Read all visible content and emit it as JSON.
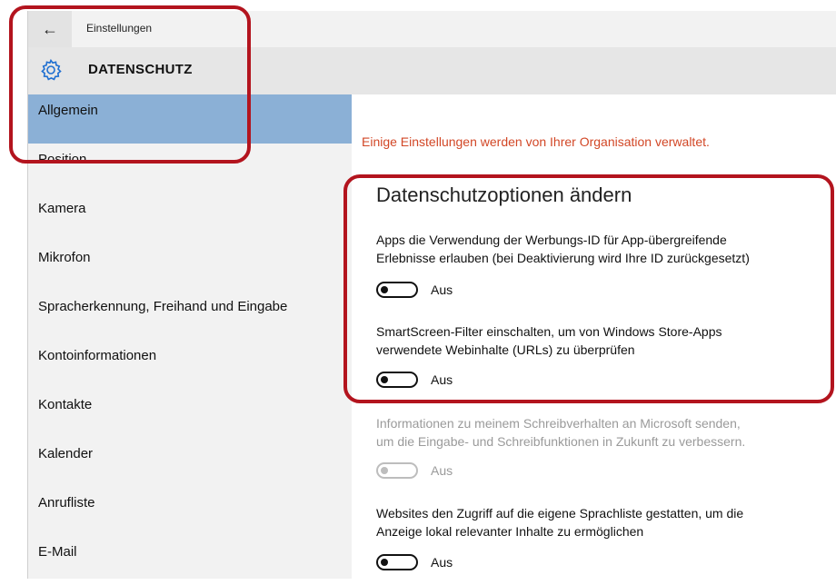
{
  "window": {
    "title": "Einstellungen",
    "back_icon": "arrow-left-icon"
  },
  "header": {
    "icon": "gear-icon",
    "title": "DATENSCHUTZ"
  },
  "sidebar": {
    "items": [
      {
        "label": "Allgemein",
        "active": true
      },
      {
        "label": "Position"
      },
      {
        "label": "Kamera"
      },
      {
        "label": "Mikrofon"
      },
      {
        "label": "Spracherkennung, Freihand und Eingabe"
      },
      {
        "label": "Kontoinformationen"
      },
      {
        "label": "Kontakte"
      },
      {
        "label": "Kalender"
      },
      {
        "label": "Anrufliste"
      },
      {
        "label": "E-Mail"
      }
    ]
  },
  "content": {
    "org_notice": "Einige Einstellungen werden von Ihrer Organisation verwaltet.",
    "section_title": "Datenschutzoptionen ändern",
    "options": [
      {
        "line1": "Apps die Verwendung der Werbungs-ID für App-übergreifende",
        "line2": "Erlebnisse erlauben (bei Deaktivierung wird Ihre ID zurückgesetzt)",
        "state": "Aus",
        "enabled": true
      },
      {
        "line1": "SmartScreen-Filter einschalten, um von Windows Store-Apps",
        "line2": "verwendete Webinhalte (URLs) zu überprüfen",
        "state": "Aus",
        "enabled": true
      },
      {
        "line1": "Informationen zu meinem Schreibverhalten an Microsoft senden,",
        "line2": "um die Eingabe- und Schreibfunktionen in Zukunft zu verbessern.",
        "state": "Aus",
        "enabled": false
      },
      {
        "line1": "Websites den Zugriff auf die eigene Sprachliste gestatten, um die",
        "line2": "Anzeige lokal relevanter Inhalte zu ermöglichen",
        "state": "Aus",
        "enabled": true
      }
    ]
  },
  "colors": {
    "accent": "#8bb0d6",
    "notice": "#d24726",
    "callout": "#b3141e"
  }
}
